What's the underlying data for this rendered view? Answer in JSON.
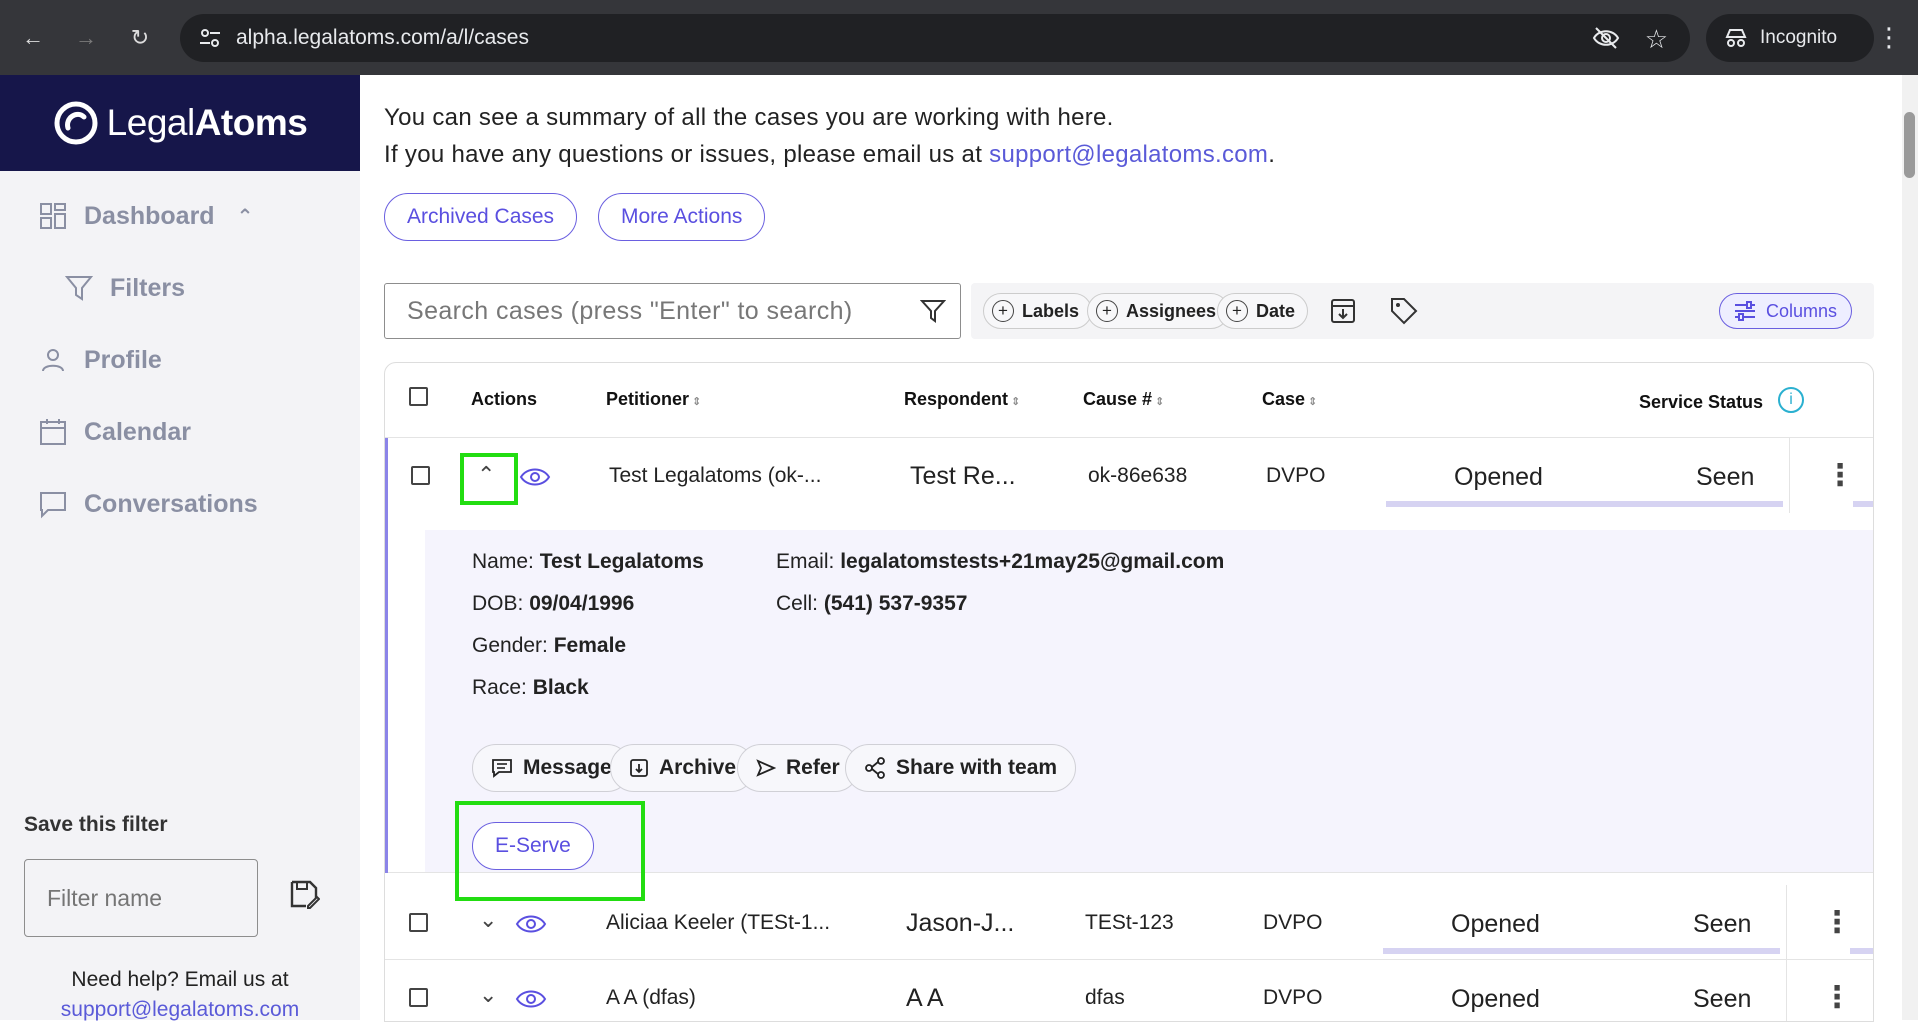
{
  "browser": {
    "url": "alpha.legalatoms.com/a/l/cases",
    "incognito_label": "Incognito"
  },
  "sidebar": {
    "logo": {
      "light": "Legal",
      "bold": "Atoms"
    },
    "items": [
      {
        "label": "Dashboard"
      },
      {
        "label": "Filters"
      },
      {
        "label": "Profile"
      },
      {
        "label": "Calendar"
      },
      {
        "label": "Conversations"
      }
    ],
    "save_filter_label": "Save this filter",
    "filter_placeholder": "Filter name",
    "help_text": "Need help? Email us at",
    "help_email": "support@legalatoms.com"
  },
  "main": {
    "intro_line1": "You can see a summary of all the cases you are working with here.",
    "intro_line2": "If you have any questions or issues, please email us at ",
    "intro_email": "support@legalatoms.com",
    "intro_period": ".",
    "archived_cases_label": "Archived Cases",
    "more_actions_label": "More Actions",
    "search_placeholder": "Search cases (press \"Enter\" to search)",
    "chips": {
      "labels": "Labels",
      "assignees": "Assignees",
      "date": "Date"
    },
    "columns_label": "Columns"
  },
  "table": {
    "headers": {
      "actions": "Actions",
      "petitioner": "Petitioner",
      "respondent": "Respondent",
      "cause": "Cause #",
      "case": "Case",
      "service_status": "Service Status"
    },
    "rows": [
      {
        "petitioner": "Test Legalatoms (ok-...",
        "respondent": "Test Re...",
        "cause": "ok-86e638",
        "case": "DVPO",
        "status": "Opened",
        "seen": "Seen"
      },
      {
        "petitioner": "Aliciaa Keeler (TESt-1...",
        "respondent": "Jason-J...",
        "cause": "TESt-123",
        "case": "DVPO",
        "status": "Opened",
        "seen": "Seen"
      },
      {
        "petitioner": "A A (dfas)",
        "respondent": "A A",
        "cause": "dfas",
        "case": "DVPO",
        "status": "Opened",
        "seen": "Seen"
      }
    ],
    "details": {
      "name_label": "Name:",
      "name": "Test Legalatoms",
      "dob_label": "DOB:",
      "dob": "09/04/1996",
      "gender_label": "Gender:",
      "gender": "Female",
      "race_label": "Race:",
      "race": "Black",
      "email_label": "Email:",
      "email": "legalatomstests+21may25@gmail.com",
      "cell_label": "Cell:",
      "cell": "(541) 537-9357",
      "buttons": {
        "message": "Message",
        "archive": "Archive",
        "refer": "Refer",
        "share": "Share with team",
        "eserve": "E-Serve"
      }
    }
  },
  "colors": {
    "accent": "#5a4fe0",
    "sidebar_header": "#16164a",
    "highlight": "#22dd11"
  }
}
